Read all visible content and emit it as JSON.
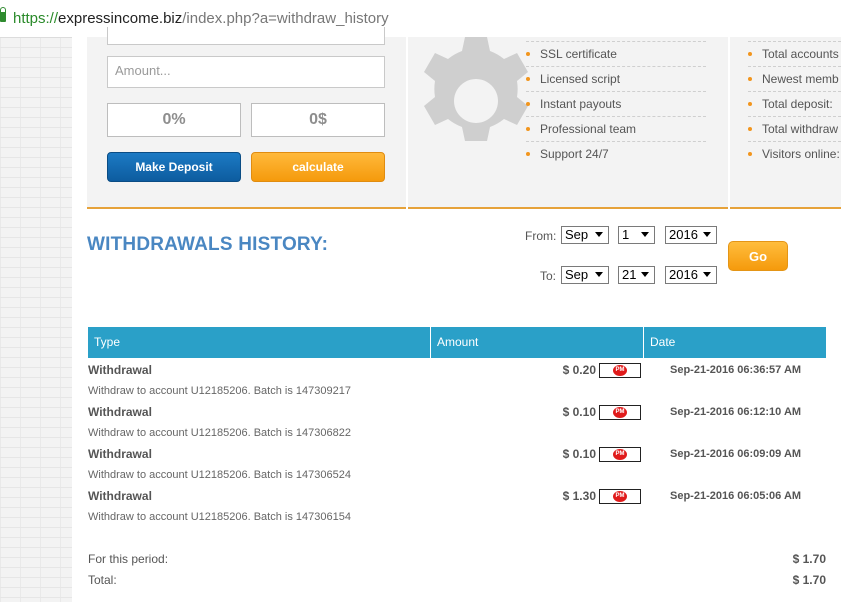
{
  "browser": {
    "url_scheme": "https://",
    "url_domain": "expressincome.biz",
    "url_path": "/index.php?a=withdraw_history"
  },
  "deposit_panel": {
    "amount_placeholder": "Amount...",
    "percent_value": "0%",
    "dollar_value": "0$",
    "make_deposit_label": "Make Deposit",
    "calculate_label": "calculate"
  },
  "features": [
    "SSL certificate",
    "Licensed script",
    "Instant payouts",
    "Professional team",
    "Support 24/7"
  ],
  "stats": [
    "Total accounts",
    "Newest memb",
    "Total deposit:",
    "Total withdraw",
    "Visitors online:"
  ],
  "page_title": "WITHDRAWALS HISTORY:",
  "filter": {
    "from_label": "From:",
    "to_label": "To:",
    "from_month": "Sep",
    "from_day": "1",
    "from_year": "2016",
    "to_month": "Sep",
    "to_day": "21",
    "to_year": "2016",
    "go_label": "Go"
  },
  "table": {
    "headers": [
      "Type",
      "Amount",
      "Date"
    ],
    "rows": [
      {
        "type": "Withdrawal",
        "desc": "Withdraw to account U12185206. Batch is 147309217",
        "amount": "$ 0.20",
        "date": "Sep-21-2016 06:36:57 AM"
      },
      {
        "type": "Withdrawal",
        "desc": "Withdraw to account U12185206. Batch is 147306822",
        "amount": "$ 0.10",
        "date": "Sep-21-2016 06:12:10 AM"
      },
      {
        "type": "Withdrawal",
        "desc": "Withdraw to account U12185206. Batch is 147306524",
        "amount": "$ 0.10",
        "date": "Sep-21-2016 06:09:09 AM"
      },
      {
        "type": "Withdrawal",
        "desc": "Withdraw to account U12185206. Batch is 147306154",
        "amount": "$ 1.30",
        "date": "Sep-21-2016 06:05:06 AM"
      }
    ],
    "pm_badge": "PM"
  },
  "totals": {
    "period_label": "For this period:",
    "period_value": "$ 1.70",
    "total_label": "Total:",
    "total_value": "$ 1.70"
  },
  "colors": {
    "accent_blue": "#4a87c2",
    "header_teal": "#2aa0c8",
    "orange": "#f59a0c"
  }
}
